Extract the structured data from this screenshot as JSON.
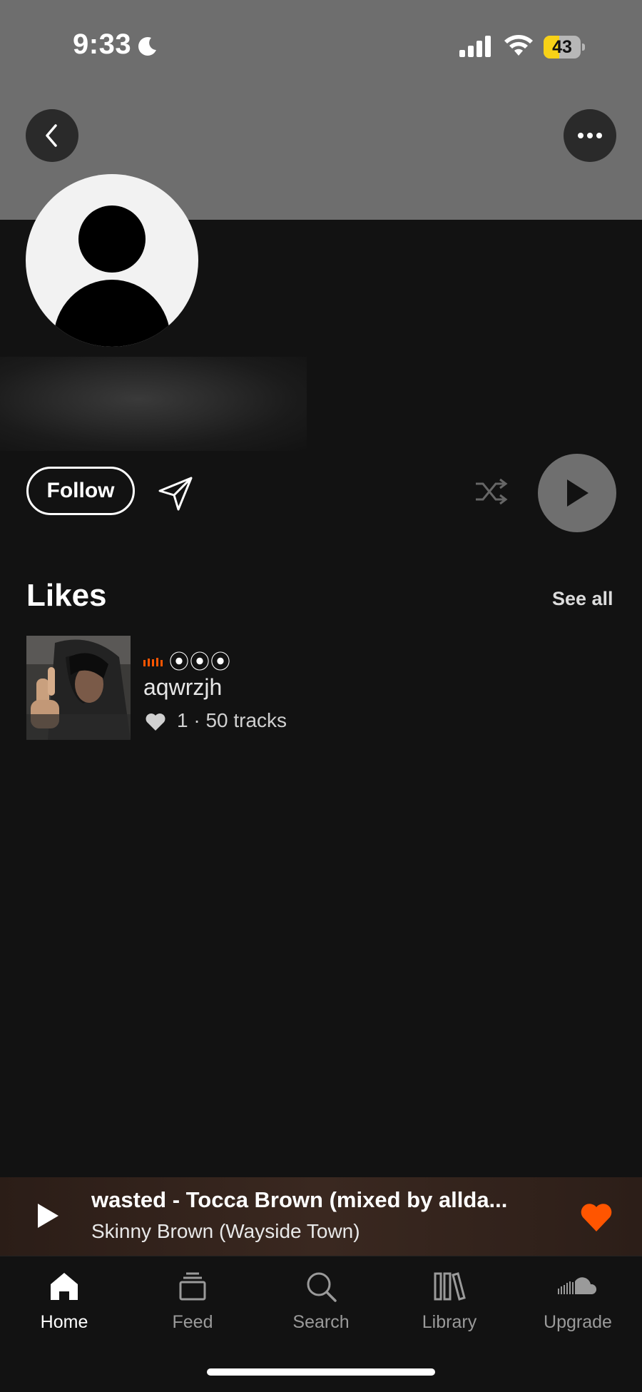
{
  "status_bar": {
    "time": "9:33",
    "battery": "43"
  },
  "profile": {
    "follow_label": "Follow"
  },
  "likes": {
    "title": "Likes",
    "see_all": "See all",
    "item": {
      "tag": "⦿⦿⦿",
      "name": "aqwrzjh",
      "meta": "1 · 50 tracks"
    }
  },
  "mini_player": {
    "title": "wasted - Tocca Brown (mixed by allda...",
    "artist": "Skinny Brown (Wayside Town)"
  },
  "tabs": [
    {
      "label": "Home",
      "icon": "home-icon"
    },
    {
      "label": "Feed",
      "icon": "feed-icon"
    },
    {
      "label": "Search",
      "icon": "search-icon"
    },
    {
      "label": "Library",
      "icon": "library-icon"
    },
    {
      "label": "Upgrade",
      "icon": "upgrade-icon"
    }
  ],
  "colors": {
    "accent": "#ff5500",
    "background": "#121212",
    "banner": "#6e6e6e"
  }
}
